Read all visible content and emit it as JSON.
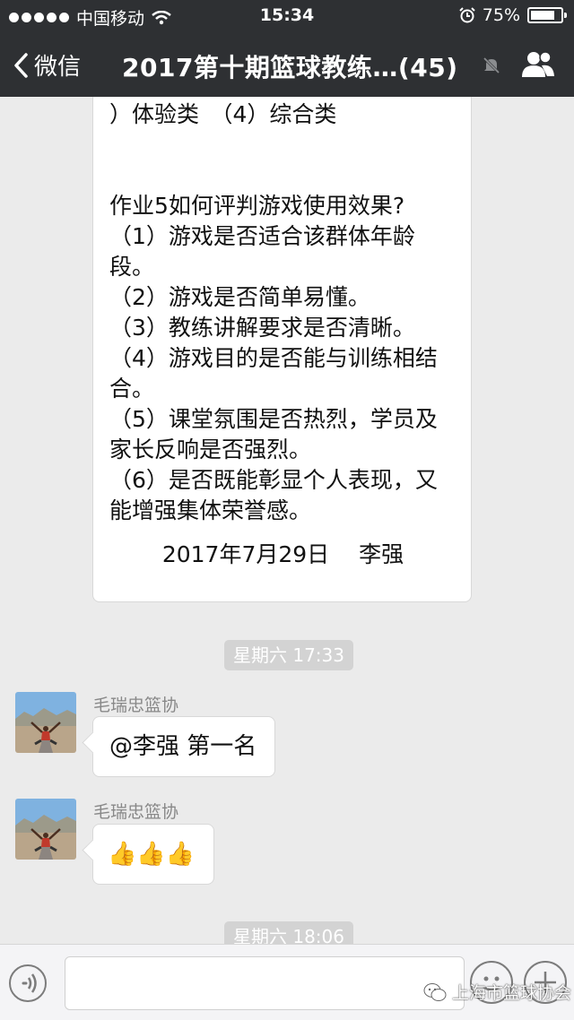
{
  "status": {
    "carrier": "中国移动",
    "time": "15:34",
    "battery": "75%",
    "battery_level": 0.75
  },
  "nav": {
    "back_label": "微信",
    "title": "2017第十期篮球教练…(45)"
  },
  "message_big": {
    "text": "）体验类　（4）综合类\n\n\n作业5如何评判游戏使用效果?\n（1）游戏是否适合该群体年龄段。\n（2）游戏是否简单易懂。\n（3）教练讲解要求是否清晰。\n（4）游戏目的是否能与训练相结合。\n（5）课堂氛围是否热烈，学员及家长反响是否强烈。\n（6）是否既能彰显个人表现，又能增强集体荣誉感。",
    "signature": "2017年7月29日　 李强"
  },
  "timestamps": [
    "星期六 17:33",
    "星期六 18:06"
  ],
  "messages": [
    {
      "sender": "毛瑞忠篮协",
      "text": "@李强 第一名"
    },
    {
      "sender": "毛瑞忠篮协",
      "text": "👍👍👍"
    }
  ],
  "input": {
    "value": ""
  },
  "watermark": "上海市篮球协会",
  "colors": {
    "topbar": "#2e3033",
    "background": "#ebebeb",
    "bubble": "#ffffff",
    "timestamp_bg": "#d3d3d3"
  }
}
